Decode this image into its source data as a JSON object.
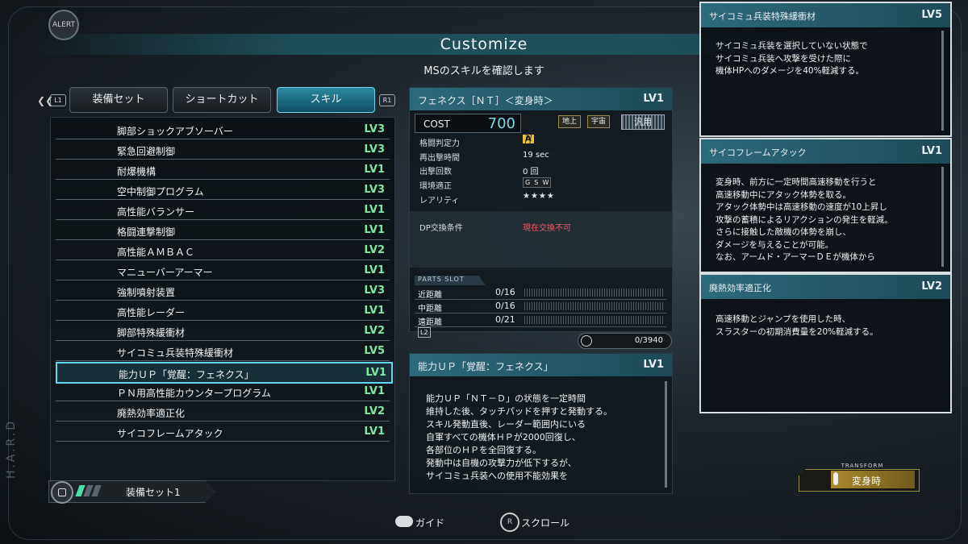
{
  "alert_label": "ALERT",
  "title": "Customize",
  "subtitle": "MSのスキルを確認します",
  "tabs": {
    "left_key": "L1",
    "right_key": "R1",
    "items": [
      {
        "label": "装備セット"
      },
      {
        "label": "ショートカット"
      },
      {
        "label": "スキル",
        "active": true
      }
    ]
  },
  "skills": [
    {
      "name": "脚部ショックアブソーバー",
      "level": "LV3"
    },
    {
      "name": "緊急回避制御",
      "level": "LV3"
    },
    {
      "name": "耐爆機構",
      "level": "LV1"
    },
    {
      "name": "空中制御プログラム",
      "level": "LV3"
    },
    {
      "name": "高性能バランサー",
      "level": "LV1"
    },
    {
      "name": "格闘連撃制御",
      "level": "LV1"
    },
    {
      "name": "高性能ＡＭＢＡＣ",
      "level": "LV2"
    },
    {
      "name": "マニューバーアーマー",
      "level": "LV1"
    },
    {
      "name": "強制噴射装置",
      "level": "LV3"
    },
    {
      "name": "高性能レーダー",
      "level": "LV1"
    },
    {
      "name": "脚部特殊緩衝材",
      "level": "LV2"
    },
    {
      "name": "サイコミュ兵装特殊緩衝材",
      "level": "LV5"
    },
    {
      "name": "能力ＵＰ「覚醒：フェネクス」",
      "level": "LV1",
      "selected": true
    },
    {
      "name": "ＰＮ用高性能カウンタープログラム",
      "level": "LV1"
    },
    {
      "name": "廃熱効率適正化",
      "level": "LV2"
    },
    {
      "name": "サイコフレームアタック",
      "level": "LV1"
    }
  ],
  "equip_set": {
    "label": "装備セット1"
  },
  "ms": {
    "name": "フェネクス［ＮＴ］＜変身時＞",
    "level": "LV1",
    "cost_label": "COST",
    "cost_value": "700",
    "terrain_ground": "地上",
    "terrain_space": "宇宙",
    "type": "汎用",
    "attrs": [
      {
        "label": "格闘判定力",
        "value": "A"
      },
      {
        "label": "再出撃時間",
        "value": "19 sec"
      },
      {
        "label": "出撃回数",
        "value": "0 回"
      },
      {
        "label": "環境適正",
        "value": "G  S  W"
      },
      {
        "label": "レアリティ",
        "value": "★★★★"
      }
    ],
    "dp_label": "DP交換条件",
    "dp_value": "現在交換不可",
    "parts_slot_label": "PARTS SLOT",
    "parts": [
      {
        "label": "近距離",
        "value": "0/16"
      },
      {
        "label": "中距離",
        "value": "0/16"
      },
      {
        "label": "遠距離",
        "value": "0/21"
      }
    ],
    "l2_label": "L2",
    "capacity": "0/3940"
  },
  "ability": {
    "name": "能力ＵＰ「覚醒：フェネクス」",
    "level": "LV1",
    "text": "能力ＵＰ「ＮＴ－Ｄ」の状態を一定時間\n維持した後、タッチパッドを押すと発動する。\nスキル発動直後、レーダー範囲内にいる\n自軍すべての機体ＨＰが2000回復し、\n各部位のＨＰを全回復する。\n発動中は自機の攻撃力が低下するが、\nサイコミュ兵装への使用不能効果を"
  },
  "right_panels": [
    {
      "name": "サイコミュ兵装特殊緩衝材",
      "level": "LV5",
      "text": "サイコミュ兵装を選択していない状態で\nサイコミュ兵装へ攻撃を受けた際に\n機体HPへのダメージを40%軽減する。"
    },
    {
      "name": "サイコフレームアタック",
      "level": "LV1",
      "text": "変身時、前方に一定時間高速移動を行うと\n高速移動中にアタック体勢を取る。\nアタック体勢中は高速移動の速度が10上昇し\n攻撃の蓄積によるリアクションの発生を軽減。\nさらに接触した敵機の体勢を崩し、\nダメージを与えることが可能。\nなお、アームド・アーマーＤＥが機体から"
    },
    {
      "name": "廃熱効率適正化",
      "level": "LV2",
      "text": "高速移動とジャンプを使用した時、\nスラスターの初期消費量を20%軽減する。"
    }
  ],
  "transform": {
    "header": "TRANSFORM",
    "label": "変身時"
  },
  "footer": {
    "guide": "ガイド",
    "scroll": "スクロール",
    "stick": "R"
  },
  "watermark": "H.A.R.D"
}
